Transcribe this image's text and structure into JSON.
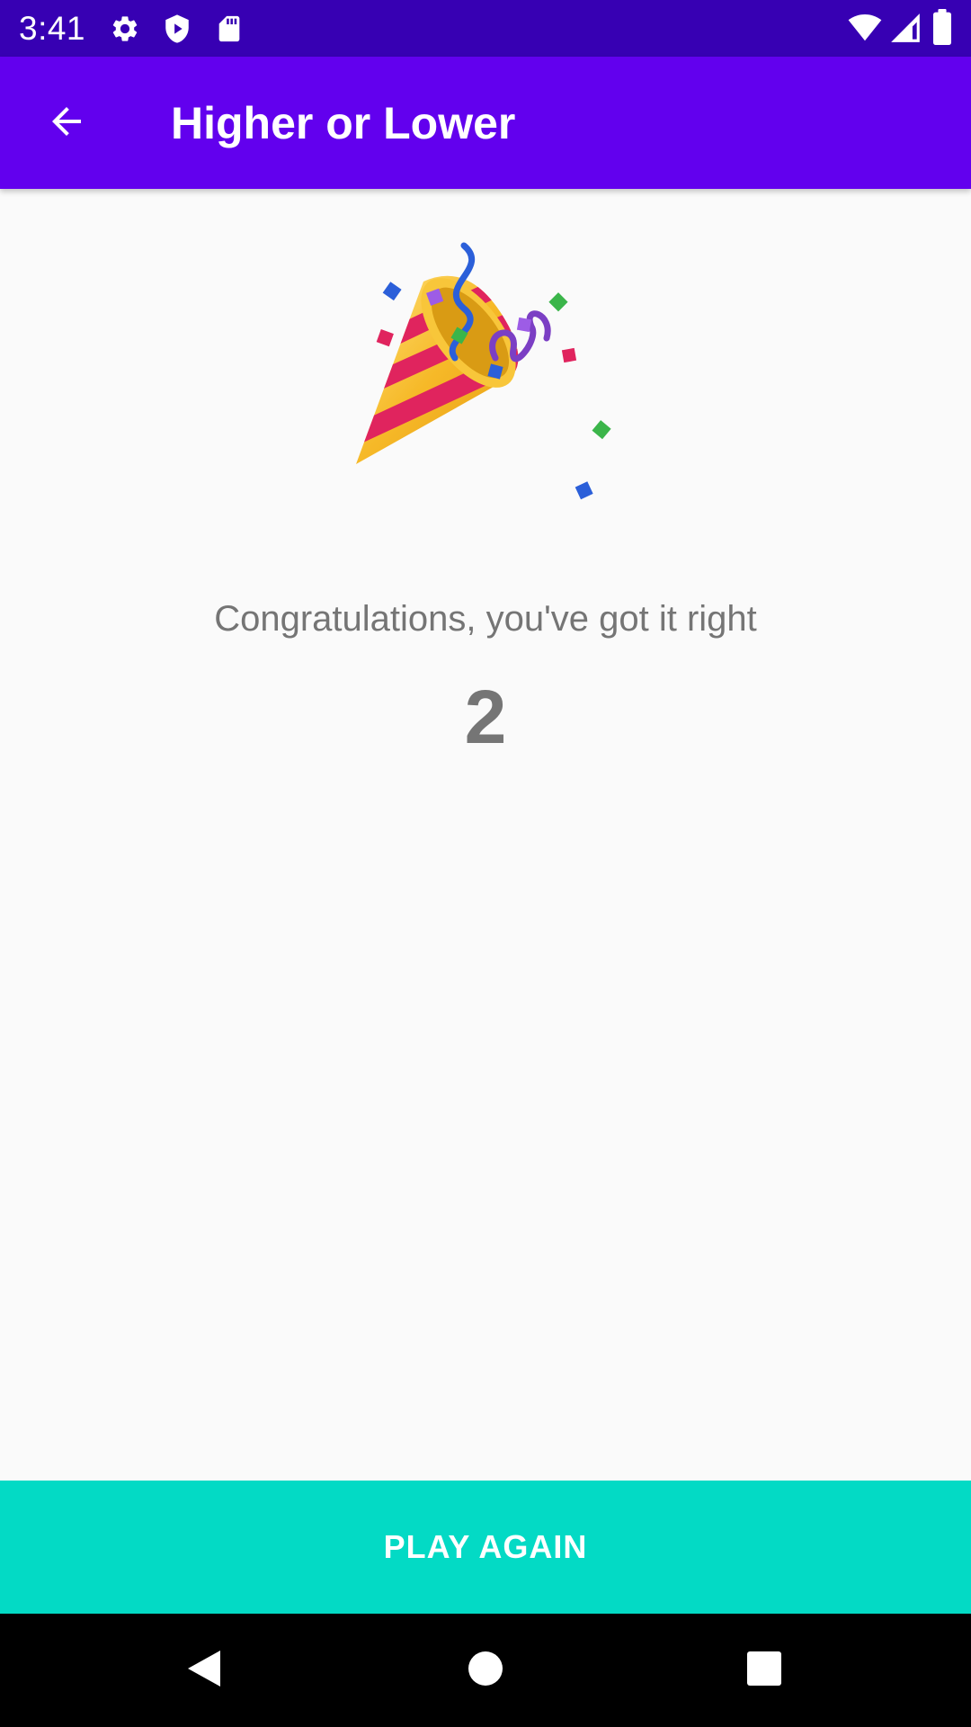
{
  "status_bar": {
    "time": "3:41",
    "left_icons": [
      "gear-icon",
      "shield-play-icon",
      "sd-card-icon"
    ],
    "right_icons": [
      "wifi-icon",
      "cellular-signal-icon",
      "battery-icon"
    ]
  },
  "app_bar": {
    "title": "Higher or Lower",
    "back_icon": "arrow-back-icon",
    "background_color": "#6200ee"
  },
  "content": {
    "hero_icon": "party-popper-icon",
    "message": "Congratulations, you've got it right",
    "score": "2"
  },
  "action": {
    "play_again_label": "PLAY AGAIN",
    "background_color": "#03dac5"
  },
  "navigation_bar": {
    "buttons": [
      "back-triangle-icon",
      "home-circle-icon",
      "recents-square-icon"
    ]
  }
}
